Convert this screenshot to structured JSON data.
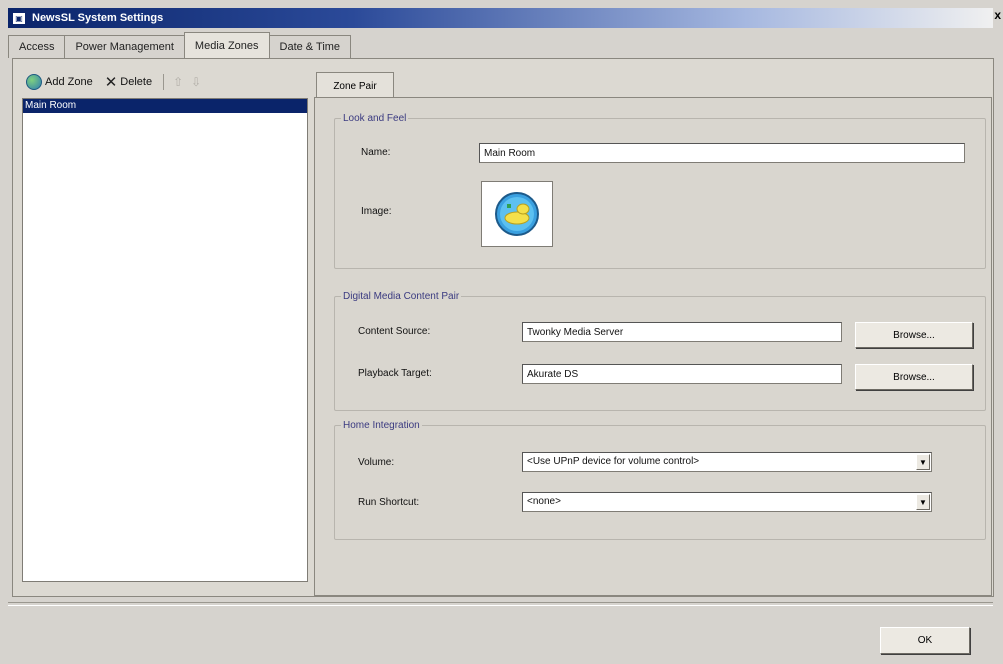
{
  "window": {
    "title": "NewsSL System Settings",
    "close_glyph": "x"
  },
  "tabs": [
    {
      "label": "Access",
      "active": false
    },
    {
      "label": "Power Management",
      "active": false
    },
    {
      "label": "Media Zones",
      "active": true
    },
    {
      "label": "Date & Time",
      "active": false
    }
  ],
  "toolbar": {
    "add_label": "Add Zone",
    "add_icon": "globe-add-icon",
    "delete_label": "Delete",
    "delete_icon": "delete-x-icon",
    "move_up_icon": "arrow-up-icon",
    "move_down_icon": "arrow-down-icon"
  },
  "zones": [
    {
      "label": "Main Room",
      "selected": true
    }
  ],
  "zone_tab": {
    "label": "Zone Pair"
  },
  "look_and_feel": {
    "legend": "Look and Feel",
    "name_label": "Name:",
    "name_value": "Main Room",
    "image_label": "Image:"
  },
  "digital_media": {
    "legend": "Digital Media Content Pair",
    "content_source_label": "Content Source:",
    "content_source_value": "Twonky Media Server",
    "playback_target_label": "Playback Target:",
    "playback_target_value": "Akurate DS",
    "browse_label": "Browse..."
  },
  "home_integration": {
    "legend": "Home Integration",
    "volume_label": "Volume:",
    "volume_value": "<Use UPnP device for volume control>",
    "run_shortcut_label": "Run Shortcut:",
    "run_shortcut_value": "<none>"
  },
  "footer": {
    "ok_label": "OK"
  },
  "colors": {
    "selection": "#0a246a",
    "titlebar": "#0a246a",
    "face": "#d6d3ce"
  }
}
